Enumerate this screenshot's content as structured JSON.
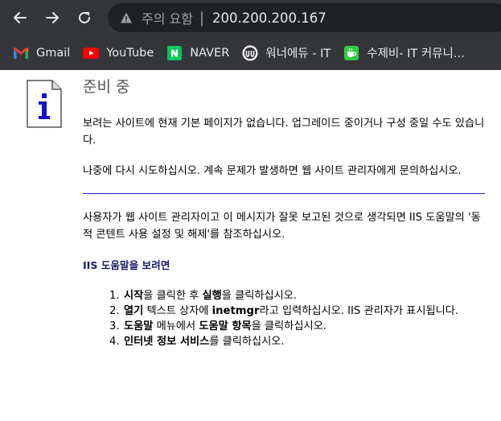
{
  "browser": {
    "security_status": "주의 요함",
    "url": "200.200.200.167",
    "colors": {
      "chrome_bg": "#35363a",
      "omnibox_bg": "#202124"
    }
  },
  "bookmarks": [
    {
      "label": "Gmail",
      "icon": "gmail-icon"
    },
    {
      "label": "YouTube",
      "icon": "youtube-icon"
    },
    {
      "label": "NAVER",
      "icon": "naver-icon"
    },
    {
      "label": "워너에듀 - IT",
      "icon": "wanner-edu-icon"
    },
    {
      "label": "수제비- IT 커뮤니...",
      "icon": "sujebi-icon"
    }
  ],
  "page": {
    "title": "준비 중",
    "para1": "보려는 사이트에 현재 기본 페이지가 없습니다. 업그레이드 중이거나 구성 중일 수도 있습니다.",
    "para2": "나중에 다시 시도하십시오. 계속 문제가 발생하면 웹 사이트 관리자에게 문의하십시오.",
    "para3": "사용자가 웹 사이트 관리자이고 이 메시지가 잘못 보고된 것으로 생각되면 IIS 도움말의 '동적 콘텐트 사용 설정 및 해제'를 참조하십시오.",
    "help_heading": "IIS 도움말을 보려면",
    "steps": [
      {
        "num": "1.",
        "b1": "시작",
        "t1": "을 클릭한 후 ",
        "b2": "실행",
        "t2": "을 클릭하십시오."
      },
      {
        "num": "2.",
        "b1": "열기",
        "t1": " 텍스트 상자에 ",
        "b2": "inetmgr",
        "t2": "라고 입력하십시오. IIS 관리자가 표시됩니다."
      },
      {
        "num": "3.",
        "b1": "도움말",
        "t1": " 메뉴에서 ",
        "b2": "도움말 항목",
        "t2": "을 클릭하십시오."
      },
      {
        "num": "4.",
        "b1": "인터넷 정보 서비스",
        "t1": "를 클릭하십시오.",
        "b2": "",
        "t2": ""
      }
    ]
  }
}
